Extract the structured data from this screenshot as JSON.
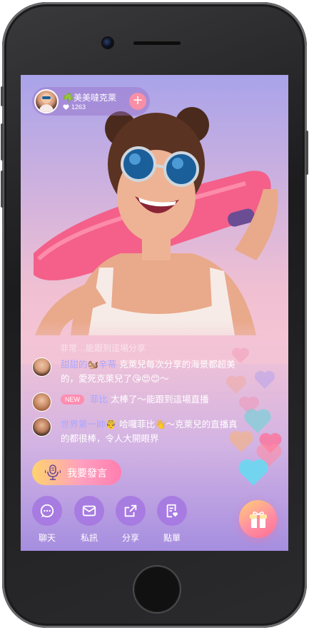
{
  "host": {
    "name": "☘️美美噠克萊",
    "likes": "1263",
    "follow_symbol": "+"
  },
  "chat": {
    "faded_message": "非常…能跟到這場分享",
    "messages": [
      {
        "username": "甜甜的🐿️辛蒂",
        "text": "克萊兒每次分享的海景都超美的，愛死克萊兒了😘😍😊～",
        "badge": ""
      },
      {
        "username": "菲比",
        "text": "太棒了～能跟到這場直播",
        "badge": "NEW"
      },
      {
        "username": "世界第一帥🤴",
        "text": "哈囉菲比👋～克萊兒的直播真的都很棒，令人大開眼界",
        "badge": ""
      }
    ]
  },
  "speak_button": {
    "label": "我要發言"
  },
  "actions": [
    {
      "label": "聊天",
      "icon": "chat-bubble-icon"
    },
    {
      "label": "私訊",
      "icon": "envelope-icon"
    },
    {
      "label": "分享",
      "icon": "share-icon"
    },
    {
      "label": "點單",
      "icon": "order-list-icon"
    }
  ],
  "gift": {
    "icon": "gift-icon"
  },
  "colors": {
    "accent_pink": "#ff7eb0",
    "accent_yellow": "#ffd36e",
    "username": "#a9a6ff",
    "action_bg": "#a578e1"
  }
}
